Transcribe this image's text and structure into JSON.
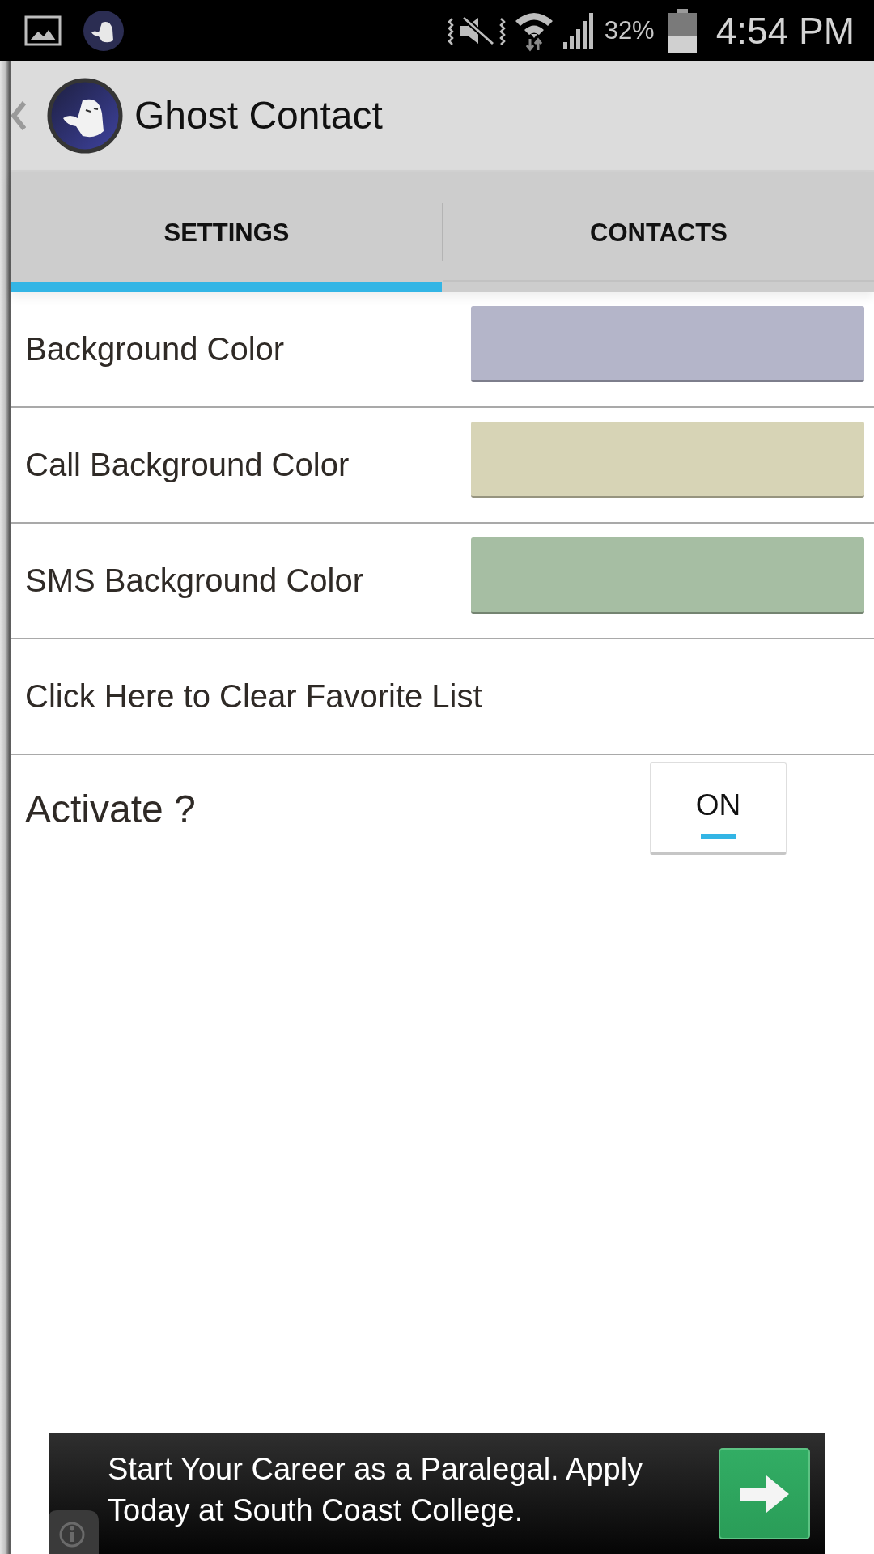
{
  "status_bar": {
    "battery": "32%",
    "time": "4:54 PM"
  },
  "app_bar": {
    "title": "Ghost Contact"
  },
  "tabs": [
    {
      "label": "SETTINGS",
      "selected": true
    },
    {
      "label": "CONTACTS",
      "selected": false
    }
  ],
  "settings": [
    {
      "kind": "color",
      "label": "Background Color",
      "color": "#b4b5c9"
    },
    {
      "kind": "color",
      "label": "Call Background Color",
      "color": "#d7d4b6"
    },
    {
      "kind": "color",
      "label": "SMS Background Color",
      "color": "#a6bea3"
    },
    {
      "kind": "action",
      "label": "Click Here to Clear Favorite List"
    }
  ],
  "activate": {
    "label": "Activate ?",
    "toggle": {
      "text": "ON",
      "on": true
    }
  },
  "ad": {
    "text": "Start Your Career as a Paralegal. Apply Today at South Coast College."
  }
}
